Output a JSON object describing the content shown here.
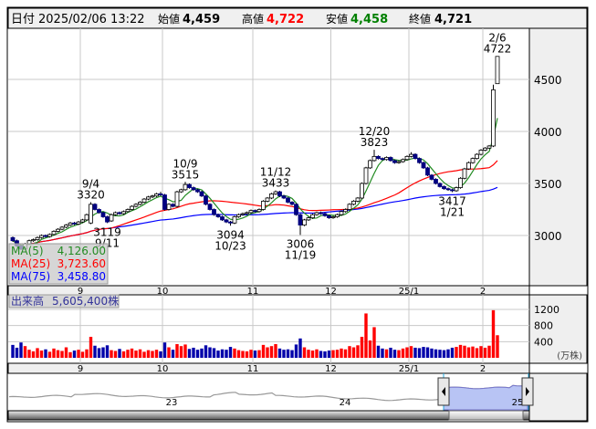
{
  "header": {
    "date_label": "日付",
    "datetime": "2025/02/06 13:22",
    "open_label": "始値",
    "open": "4,459",
    "high_label": "高値",
    "high": "4,722",
    "low_label": "安値",
    "low": "4,458",
    "close_label": "終値",
    "close": "4,721"
  },
  "colors": {
    "up_volume": "#ff0000",
    "down_volume": "#0000aa",
    "down_candle": "#000080",
    "ma5": "#228b22",
    "ma25": "#ff0000",
    "ma75": "#0000ff",
    "high_text": "#ff0000",
    "low_text": "#008000"
  },
  "ma_legend": [
    {
      "label": "MA(5)",
      "value": "4,126.00"
    },
    {
      "label": "MA(25)",
      "value": "3,723.60"
    },
    {
      "label": "MA(75)",
      "value": "3,458.80"
    }
  ],
  "volume_legend": {
    "label": "出来高",
    "value": "5,605,400株"
  },
  "volume_unit": "(万株)",
  "chart_data": {
    "type": "candlestick",
    "price_axis": {
      "ticks": [
        3000,
        3500,
        4000,
        4500
      ],
      "range": [
        2780,
        5250
      ]
    },
    "volume_axis": {
      "ticks": [
        400,
        800,
        1200
      ],
      "range": [
        0,
        1250
      ],
      "unit": "万株"
    },
    "months": [
      {
        "label": "9",
        "index": 17
      },
      {
        "label": "10",
        "index": 37
      },
      {
        "label": "11",
        "index": 59
      },
      {
        "label": "12",
        "index": 78
      },
      {
        "label": "25/1",
        "index": 97
      },
      {
        "label": "2",
        "index": 115
      }
    ],
    "annotations": [
      {
        "index": 19,
        "date": "9/4",
        "price": "3320",
        "pos": "above"
      },
      {
        "index": 23,
        "date": "9/11",
        "price": "3119",
        "pos": "below"
      },
      {
        "index": 42,
        "date": "10/9",
        "price": "3515",
        "pos": "above"
      },
      {
        "index": 53,
        "date": "10/23",
        "price": "3094",
        "pos": "below"
      },
      {
        "index": 64,
        "date": "11/12",
        "price": "3433",
        "pos": "above"
      },
      {
        "index": 70,
        "date": "11/19",
        "price": "3006",
        "pos": "below"
      },
      {
        "index": 88,
        "date": "12/20",
        "price": "3823",
        "pos": "above"
      },
      {
        "index": 107,
        "date": "1/21",
        "price": "3417",
        "pos": "below"
      },
      {
        "index": 118,
        "date": "2/6",
        "price": "4722",
        "pos": "above"
      }
    ],
    "ohlc": [
      [
        2980,
        2990,
        2940,
        2950
      ],
      [
        2950,
        2960,
        2890,
        2900
      ],
      [
        2900,
        2910,
        2860,
        2870
      ],
      [
        2870,
        2930,
        2860,
        2920
      ],
      [
        2920,
        2960,
        2910,
        2950
      ],
      [
        2950,
        2970,
        2940,
        2960
      ],
      [
        2960,
        2990,
        2950,
        2980
      ],
      [
        2980,
        3010,
        2970,
        3000
      ],
      [
        3000,
        3010,
        2980,
        2990
      ],
      [
        2990,
        3020,
        2980,
        3010
      ],
      [
        3010,
        3050,
        3000,
        3040
      ],
      [
        3040,
        3070,
        3030,
        3060
      ],
      [
        3060,
        3090,
        3050,
        3080
      ],
      [
        3080,
        3110,
        3070,
        3100
      ],
      [
        3100,
        3130,
        3090,
        3120
      ],
      [
        3120,
        3130,
        3100,
        3110
      ],
      [
        3110,
        3140,
        3100,
        3130
      ],
      [
        3130,
        3160,
        3120,
        3150
      ],
      [
        3150,
        3210,
        3140,
        3200
      ],
      [
        3120,
        3320,
        3110,
        3300
      ],
      [
        3300,
        3310,
        3240,
        3250
      ],
      [
        3250,
        3260,
        3210,
        3220
      ],
      [
        3220,
        3230,
        3170,
        3180
      ],
      [
        3180,
        3190,
        3119,
        3130
      ],
      [
        3140,
        3210,
        3130,
        3200
      ],
      [
        3200,
        3230,
        3190,
        3220
      ],
      [
        3220,
        3230,
        3200,
        3210
      ],
      [
        3210,
        3240,
        3200,
        3230
      ],
      [
        3230,
        3260,
        3220,
        3250
      ],
      [
        3250,
        3290,
        3240,
        3280
      ],
      [
        3280,
        3310,
        3270,
        3300
      ],
      [
        3300,
        3330,
        3290,
        3320
      ],
      [
        3320,
        3360,
        3310,
        3350
      ],
      [
        3350,
        3380,
        3340,
        3370
      ],
      [
        3370,
        3390,
        3360,
        3380
      ],
      [
        3380,
        3410,
        3370,
        3400
      ],
      [
        3400,
        3420,
        3380,
        3390
      ],
      [
        3390,
        3400,
        3240,
        3250
      ],
      [
        3250,
        3310,
        3240,
        3300
      ],
      [
        3300,
        3310,
        3270,
        3280
      ],
      [
        3280,
        3430,
        3270,
        3420
      ],
      [
        3420,
        3450,
        3410,
        3440
      ],
      [
        3440,
        3515,
        3430,
        3490
      ],
      [
        3490,
        3500,
        3450,
        3460
      ],
      [
        3460,
        3470,
        3430,
        3440
      ],
      [
        3440,
        3450,
        3410,
        3420
      ],
      [
        3420,
        3430,
        3370,
        3380
      ],
      [
        3380,
        3390,
        3290,
        3300
      ],
      [
        3300,
        3310,
        3240,
        3250
      ],
      [
        3250,
        3260,
        3190,
        3200
      ],
      [
        3200,
        3210,
        3170,
        3180
      ],
      [
        3180,
        3190,
        3140,
        3150
      ],
      [
        3150,
        3160,
        3120,
        3130
      ],
      [
        3130,
        3140,
        3094,
        3120
      ],
      [
        3120,
        3190,
        3110,
        3180
      ],
      [
        3180,
        3210,
        3170,
        3200
      ],
      [
        3200,
        3220,
        3190,
        3210
      ],
      [
        3210,
        3230,
        3200,
        3220
      ],
      [
        3220,
        3250,
        3210,
        3240
      ],
      [
        3240,
        3250,
        3220,
        3230
      ],
      [
        3230,
        3260,
        3220,
        3250
      ],
      [
        3250,
        3340,
        3240,
        3330
      ],
      [
        3330,
        3370,
        3320,
        3360
      ],
      [
        3360,
        3410,
        3350,
        3400
      ],
      [
        3400,
        3433,
        3390,
        3420
      ],
      [
        3420,
        3430,
        3370,
        3380
      ],
      [
        3380,
        3390,
        3350,
        3360
      ],
      [
        3360,
        3370,
        3310,
        3320
      ],
      [
        3320,
        3330,
        3290,
        3300
      ],
      [
        3300,
        3310,
        3190,
        3200
      ],
      [
        3200,
        3210,
        3006,
        3100
      ],
      [
        3100,
        3160,
        3090,
        3150
      ],
      [
        3150,
        3180,
        3140,
        3170
      ],
      [
        3170,
        3210,
        3160,
        3200
      ],
      [
        3200,
        3230,
        3190,
        3220
      ],
      [
        3220,
        3230,
        3200,
        3210
      ],
      [
        3210,
        3220,
        3180,
        3190
      ],
      [
        3190,
        3200,
        3160,
        3170
      ],
      [
        3170,
        3190,
        3160,
        3180
      ],
      [
        3180,
        3210,
        3170,
        3200
      ],
      [
        3200,
        3240,
        3190,
        3230
      ],
      [
        3230,
        3260,
        3220,
        3250
      ],
      [
        3250,
        3310,
        3240,
        3300
      ],
      [
        3300,
        3340,
        3290,
        3330
      ],
      [
        3330,
        3370,
        3320,
        3360
      ],
      [
        3360,
        3510,
        3350,
        3500
      ],
      [
        3500,
        3660,
        3490,
        3650
      ],
      [
        3650,
        3730,
        3640,
        3720
      ],
      [
        3720,
        3823,
        3710,
        3760
      ],
      [
        3760,
        3770,
        3730,
        3740
      ],
      [
        3740,
        3750,
        3720,
        3730
      ],
      [
        3730,
        3760,
        3720,
        3750
      ],
      [
        3750,
        3760,
        3710,
        3720
      ],
      [
        3720,
        3730,
        3690,
        3700
      ],
      [
        3700,
        3720,
        3690,
        3710
      ],
      [
        3710,
        3740,
        3700,
        3730
      ],
      [
        3730,
        3770,
        3720,
        3760
      ],
      [
        3760,
        3800,
        3750,
        3780
      ],
      [
        3780,
        3790,
        3730,
        3740
      ],
      [
        3740,
        3750,
        3690,
        3700
      ],
      [
        3700,
        3710,
        3640,
        3650
      ],
      [
        3650,
        3660,
        3570,
        3580
      ],
      [
        3580,
        3590,
        3530,
        3540
      ],
      [
        3540,
        3550,
        3490,
        3500
      ],
      [
        3500,
        3510,
        3460,
        3470
      ],
      [
        3470,
        3480,
        3440,
        3450
      ],
      [
        3450,
        3460,
        3430,
        3440
      ],
      [
        3440,
        3450,
        3417,
        3430
      ],
      [
        3430,
        3470,
        3420,
        3460
      ],
      [
        3460,
        3560,
        3450,
        3550
      ],
      [
        3550,
        3650,
        3540,
        3640
      ],
      [
        3640,
        3710,
        3630,
        3700
      ],
      [
        3700,
        3750,
        3690,
        3740
      ],
      [
        3740,
        3790,
        3730,
        3780
      ],
      [
        3780,
        3830,
        3770,
        3820
      ],
      [
        3820,
        3850,
        3810,
        3840
      ],
      [
        3840,
        3870,
        3830,
        3860
      ],
      [
        3860,
        4450,
        3850,
        4400
      ],
      [
        4459,
        4722,
        4458,
        4721
      ]
    ],
    "volume": [
      320,
      250,
      380,
      290,
      200,
      160,
      240,
      180,
      210,
      150,
      230,
      190,
      170,
      260,
      140,
      180,
      200,
      150,
      210,
      520,
      300,
      240,
      260,
      310,
      190,
      170,
      220,
      160,
      200,
      230,
      180,
      210,
      150,
      190,
      170,
      200,
      160,
      380,
      260,
      200,
      340,
      290,
      330,
      220,
      250,
      200,
      230,
      310,
      260,
      240,
      180,
      210,
      200,
      270,
      230,
      190,
      170,
      160,
      200,
      180,
      190,
      320,
      260,
      290,
      340,
      230,
      200,
      210,
      190,
      330,
      480,
      260,
      200,
      180,
      210,
      170,
      160,
      180,
      190,
      200,
      230,
      210,
      290,
      260,
      310,
      520,
      1100,
      430,
      760,
      300,
      230,
      210,
      250,
      200,
      190,
      230,
      260,
      290,
      250,
      240,
      270,
      260,
      230,
      210,
      200,
      190,
      210,
      250,
      270,
      320,
      300,
      260,
      280,
      240,
      290,
      250,
      300,
      1180,
      560
    ],
    "navigator": {
      "labels": [
        "23",
        "24",
        "25"
      ]
    }
  }
}
